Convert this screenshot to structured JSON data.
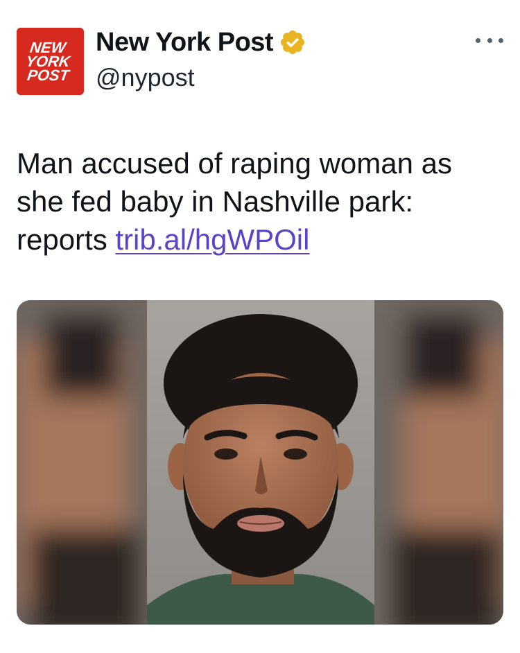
{
  "tweet": {
    "author": {
      "display_name": "New York Post",
      "handle": "@nypost",
      "verified": true,
      "verified_badge_color": "#e8b424",
      "avatar": {
        "lines": [
          "NEW",
          "YORK",
          "POST"
        ],
        "background": "#d62a21",
        "text_color": "#ffffff"
      }
    },
    "more_menu_icon": "more-horizontal-icon",
    "text": "Man accused of raping woman as she fed baby in Nashville park: reports",
    "link_text": "trib.al/hgWPOil",
    "link_color": "#5b43c9",
    "media": {
      "icon": "mugshot-photo"
    }
  }
}
